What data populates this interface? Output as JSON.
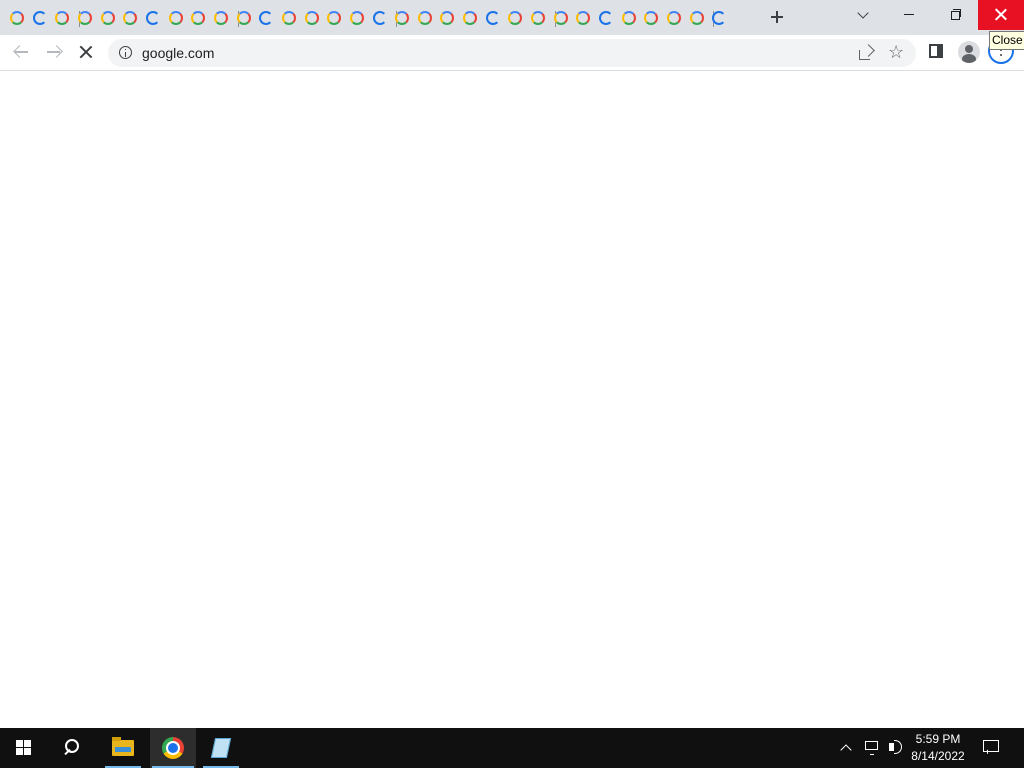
{
  "tabs": {
    "count_visible": 32,
    "new_tab_icon": "plus-icon",
    "tab_search_icon": "chevron-down-icon"
  },
  "window_controls": {
    "minimize_icon": "minimize-icon",
    "restore_icon": "restore-icon",
    "close_icon": "close-icon",
    "close_tooltip": "Close"
  },
  "toolbar": {
    "url": "google.com",
    "back_icon": "back-arrow-icon",
    "forward_icon": "forward-arrow-icon",
    "stop_icon": "stop-loading-icon",
    "site_info_icon": "info-icon",
    "share_icon": "share-icon",
    "bookmark_icon": "star-icon",
    "side_panel_icon": "side-panel-icon",
    "profile_icon": "profile-icon",
    "menu_icon": "kebab-menu-icon"
  },
  "taskbar": {
    "start_icon": "windows-start-icon",
    "search_icon": "search-icon",
    "apps": [
      {
        "name": "File Explorer",
        "icon": "folder-icon"
      },
      {
        "name": "Google Chrome",
        "icon": "chrome-icon",
        "active": true
      },
      {
        "name": "Notepad",
        "icon": "notepad-icon"
      }
    ],
    "tray": {
      "chevron_icon": "chevron-up-icon",
      "network_icon": "network-icon",
      "volume_icon": "volume-icon",
      "time": "5:59 PM",
      "date": "8/14/2022",
      "notification_icon": "notification-icon"
    }
  },
  "colors": {
    "tabstrip_bg": "#dee1e6",
    "close_red": "#e81123",
    "accent_blue": "#1a73e8",
    "taskbar_bg": "#101010"
  }
}
